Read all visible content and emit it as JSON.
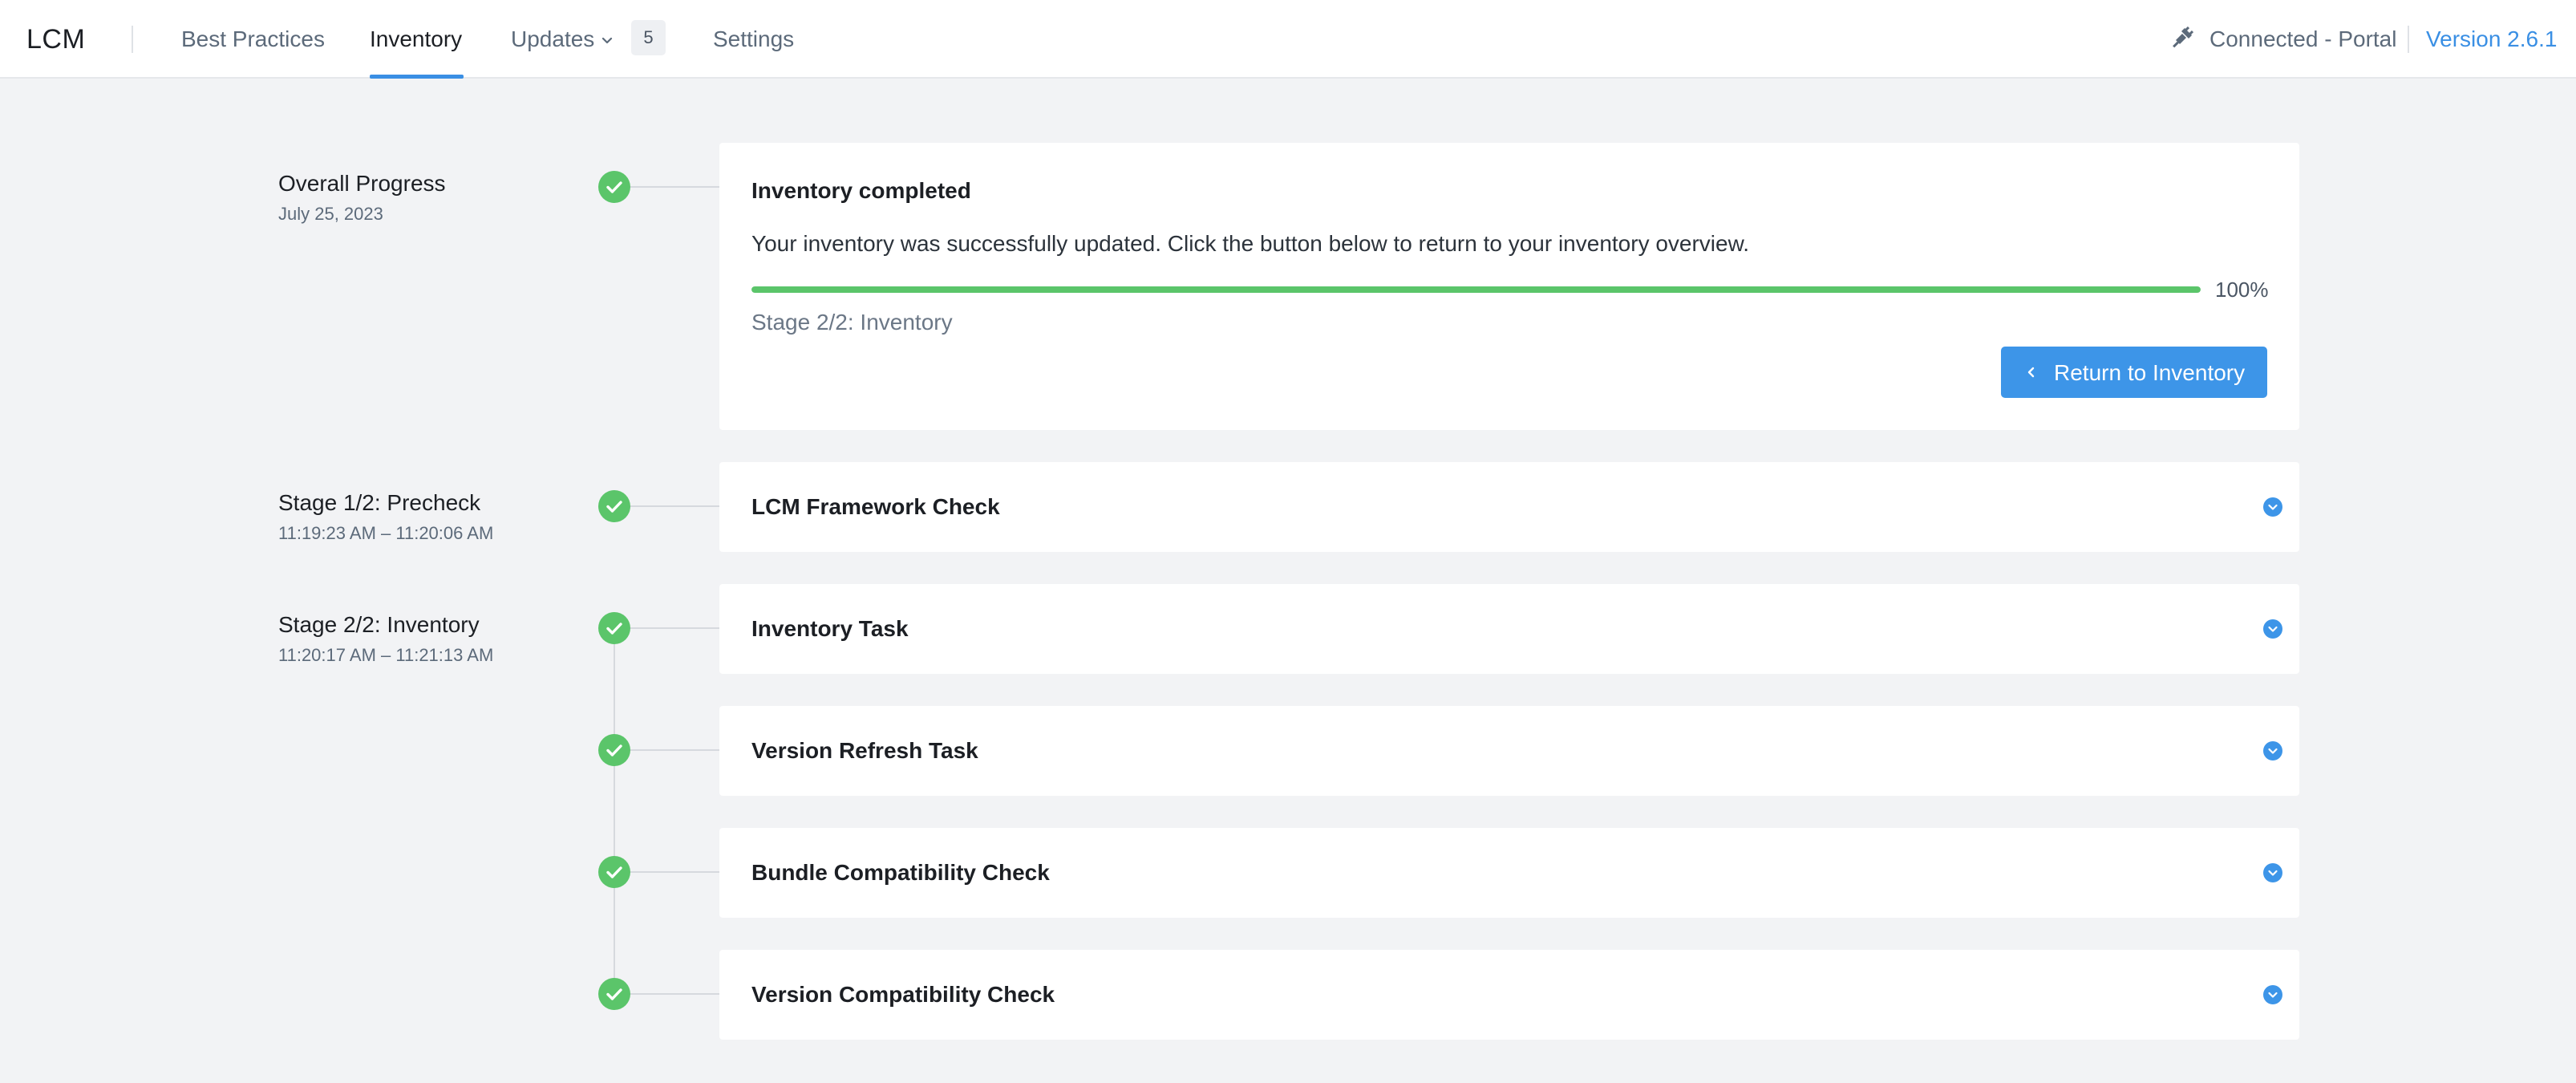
{
  "app": {
    "title": "LCM"
  },
  "nav": {
    "items": [
      {
        "label": "Best Practices"
      },
      {
        "label": "Inventory"
      },
      {
        "label": "Updates"
      },
      {
        "label": "Settings"
      }
    ],
    "active": "Inventory",
    "updates_count": "5",
    "connection_status": "Connected - Portal",
    "version": "Version 2.6.1"
  },
  "colors": {
    "accent": "#3a8fe4",
    "success": "#5bc56a",
    "background": "#f2f3f5"
  },
  "overall": {
    "label": "Overall Progress",
    "date": "July 25, 2023",
    "title": "Inventory completed",
    "message": "Your inventory was successfully updated. Click the button below to return to your inventory overview.",
    "progress_percent": 100,
    "progress_label": "100%",
    "stage_label": "Stage 2/2: Inventory",
    "button_label": "Return to Inventory"
  },
  "stages": [
    {
      "label": "Stage 1/2: Precheck",
      "time": "11:19:23 AM – 11:20:06 AM",
      "tasks": [
        "LCM Framework Check"
      ]
    },
    {
      "label": "Stage 2/2: Inventory",
      "time": "11:20:17 AM – 11:21:13 AM",
      "tasks": [
        "Inventory Task",
        "Version Refresh Task",
        "Bundle Compatibility Check",
        "Version Compatibility Check"
      ]
    }
  ],
  "icons": {
    "step_status": "check-circle-icon",
    "expand": "chevron-circle-down-icon",
    "connection": "plug-icon",
    "back": "chevron-left-icon"
  }
}
